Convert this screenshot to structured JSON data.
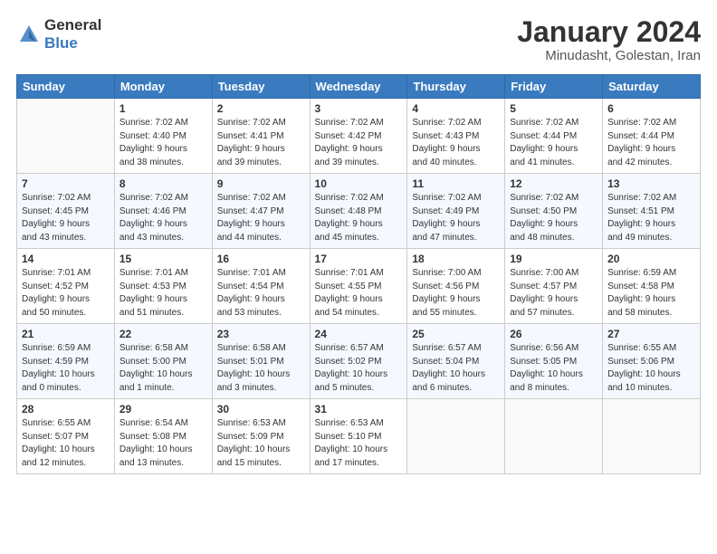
{
  "header": {
    "logo_line1": "General",
    "logo_line2": "Blue",
    "month": "January 2024",
    "location": "Minudasht, Golestan, Iran"
  },
  "days_of_week": [
    "Sunday",
    "Monday",
    "Tuesday",
    "Wednesday",
    "Thursday",
    "Friday",
    "Saturday"
  ],
  "weeks": [
    [
      {
        "day": "",
        "info": ""
      },
      {
        "day": "1",
        "info": "Sunrise: 7:02 AM\nSunset: 4:40 PM\nDaylight: 9 hours\nand 38 minutes."
      },
      {
        "day": "2",
        "info": "Sunrise: 7:02 AM\nSunset: 4:41 PM\nDaylight: 9 hours\nand 39 minutes."
      },
      {
        "day": "3",
        "info": "Sunrise: 7:02 AM\nSunset: 4:42 PM\nDaylight: 9 hours\nand 39 minutes."
      },
      {
        "day": "4",
        "info": "Sunrise: 7:02 AM\nSunset: 4:43 PM\nDaylight: 9 hours\nand 40 minutes."
      },
      {
        "day": "5",
        "info": "Sunrise: 7:02 AM\nSunset: 4:44 PM\nDaylight: 9 hours\nand 41 minutes."
      },
      {
        "day": "6",
        "info": "Sunrise: 7:02 AM\nSunset: 4:44 PM\nDaylight: 9 hours\nand 42 minutes."
      }
    ],
    [
      {
        "day": "7",
        "info": "Sunrise: 7:02 AM\nSunset: 4:45 PM\nDaylight: 9 hours\nand 43 minutes."
      },
      {
        "day": "8",
        "info": "Sunrise: 7:02 AM\nSunset: 4:46 PM\nDaylight: 9 hours\nand 43 minutes."
      },
      {
        "day": "9",
        "info": "Sunrise: 7:02 AM\nSunset: 4:47 PM\nDaylight: 9 hours\nand 44 minutes."
      },
      {
        "day": "10",
        "info": "Sunrise: 7:02 AM\nSunset: 4:48 PM\nDaylight: 9 hours\nand 45 minutes."
      },
      {
        "day": "11",
        "info": "Sunrise: 7:02 AM\nSunset: 4:49 PM\nDaylight: 9 hours\nand 47 minutes."
      },
      {
        "day": "12",
        "info": "Sunrise: 7:02 AM\nSunset: 4:50 PM\nDaylight: 9 hours\nand 48 minutes."
      },
      {
        "day": "13",
        "info": "Sunrise: 7:02 AM\nSunset: 4:51 PM\nDaylight: 9 hours\nand 49 minutes."
      }
    ],
    [
      {
        "day": "14",
        "info": "Sunrise: 7:01 AM\nSunset: 4:52 PM\nDaylight: 9 hours\nand 50 minutes."
      },
      {
        "day": "15",
        "info": "Sunrise: 7:01 AM\nSunset: 4:53 PM\nDaylight: 9 hours\nand 51 minutes."
      },
      {
        "day": "16",
        "info": "Sunrise: 7:01 AM\nSunset: 4:54 PM\nDaylight: 9 hours\nand 53 minutes."
      },
      {
        "day": "17",
        "info": "Sunrise: 7:01 AM\nSunset: 4:55 PM\nDaylight: 9 hours\nand 54 minutes."
      },
      {
        "day": "18",
        "info": "Sunrise: 7:00 AM\nSunset: 4:56 PM\nDaylight: 9 hours\nand 55 minutes."
      },
      {
        "day": "19",
        "info": "Sunrise: 7:00 AM\nSunset: 4:57 PM\nDaylight: 9 hours\nand 57 minutes."
      },
      {
        "day": "20",
        "info": "Sunrise: 6:59 AM\nSunset: 4:58 PM\nDaylight: 9 hours\nand 58 minutes."
      }
    ],
    [
      {
        "day": "21",
        "info": "Sunrise: 6:59 AM\nSunset: 4:59 PM\nDaylight: 10 hours\nand 0 minutes."
      },
      {
        "day": "22",
        "info": "Sunrise: 6:58 AM\nSunset: 5:00 PM\nDaylight: 10 hours\nand 1 minute."
      },
      {
        "day": "23",
        "info": "Sunrise: 6:58 AM\nSunset: 5:01 PM\nDaylight: 10 hours\nand 3 minutes."
      },
      {
        "day": "24",
        "info": "Sunrise: 6:57 AM\nSunset: 5:02 PM\nDaylight: 10 hours\nand 5 minutes."
      },
      {
        "day": "25",
        "info": "Sunrise: 6:57 AM\nSunset: 5:04 PM\nDaylight: 10 hours\nand 6 minutes."
      },
      {
        "day": "26",
        "info": "Sunrise: 6:56 AM\nSunset: 5:05 PM\nDaylight: 10 hours\nand 8 minutes."
      },
      {
        "day": "27",
        "info": "Sunrise: 6:55 AM\nSunset: 5:06 PM\nDaylight: 10 hours\nand 10 minutes."
      }
    ],
    [
      {
        "day": "28",
        "info": "Sunrise: 6:55 AM\nSunset: 5:07 PM\nDaylight: 10 hours\nand 12 minutes."
      },
      {
        "day": "29",
        "info": "Sunrise: 6:54 AM\nSunset: 5:08 PM\nDaylight: 10 hours\nand 13 minutes."
      },
      {
        "day": "30",
        "info": "Sunrise: 6:53 AM\nSunset: 5:09 PM\nDaylight: 10 hours\nand 15 minutes."
      },
      {
        "day": "31",
        "info": "Sunrise: 6:53 AM\nSunset: 5:10 PM\nDaylight: 10 hours\nand 17 minutes."
      },
      {
        "day": "",
        "info": ""
      },
      {
        "day": "",
        "info": ""
      },
      {
        "day": "",
        "info": ""
      }
    ]
  ]
}
